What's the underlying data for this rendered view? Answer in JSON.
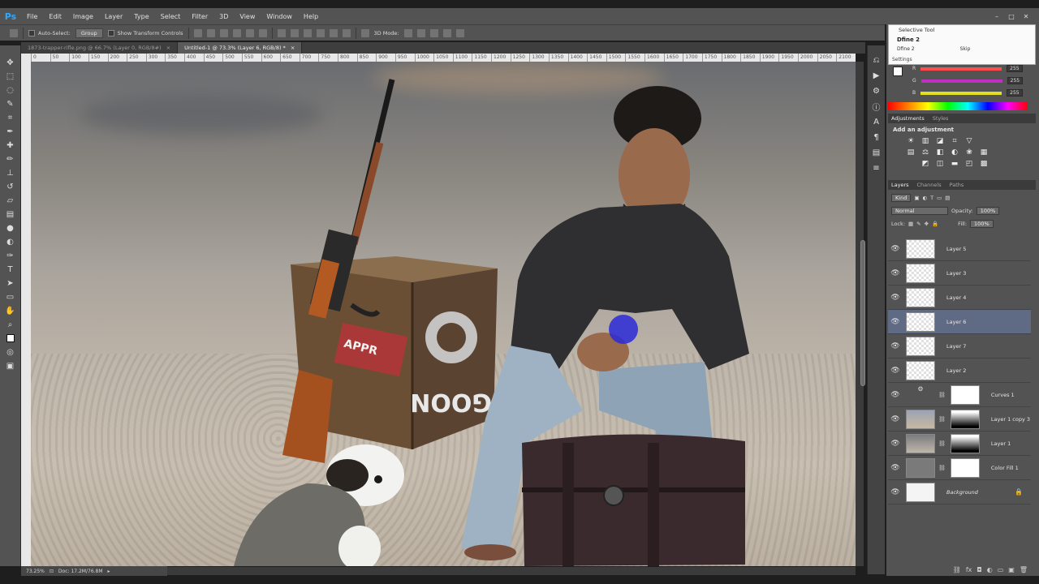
{
  "app": {
    "logo": "Ps"
  },
  "menu": [
    "File",
    "Edit",
    "Image",
    "Layer",
    "Type",
    "Select",
    "Filter",
    "3D",
    "View",
    "Window",
    "Help"
  ],
  "window_controls": [
    "–",
    "□",
    "✕"
  ],
  "options": {
    "auto_select_label": "Auto-Select:",
    "auto_select_value": "Group",
    "transform_label": "Show Transform Controls",
    "mode_label": "3D Mode:"
  },
  "tabs": [
    {
      "label": "1873-trapper-rifle.png @ 66.7% (Layer 0, RGB/8#)",
      "close": "×"
    },
    {
      "label": "Untitled-1 @ 73.3% (Layer 6, RGB/8) *",
      "close": "×"
    }
  ],
  "ruler": [
    "0",
    "50",
    "100",
    "150",
    "200",
    "250",
    "300",
    "350",
    "400",
    "450",
    "500",
    "550",
    "600",
    "650",
    "700",
    "750",
    "800",
    "850",
    "900",
    "950",
    "1000",
    "1050",
    "1100",
    "1150",
    "1200",
    "1250",
    "1300",
    "1350",
    "1400",
    "1450",
    "1500",
    "1550",
    "1600",
    "1650",
    "1700",
    "1750",
    "1800",
    "1850",
    "1900",
    "1950",
    "2000",
    "2050",
    "2100"
  ],
  "status": {
    "zoom": "73.25%",
    "doc": "Doc: 17.2M/76.8M"
  },
  "selective_tool": {
    "title": "Selective Tool",
    "name": "Dfine 2",
    "row_left": "Dfine 2",
    "row_right": "Skip",
    "settings": "Settings"
  },
  "color": {
    "labels": [
      "R",
      "G",
      "B"
    ],
    "values": [
      "255",
      "255",
      "255"
    ],
    "bar_colors": [
      "#ff4d4d",
      "#c030c0",
      "#e0e020"
    ]
  },
  "adjustments": {
    "tabs": [
      "Adjustments",
      "Styles"
    ],
    "label": "Add an adjustment",
    "icons": [
      "☀",
      "▥",
      "◪",
      "⌗",
      "▽",
      "",
      "▤",
      "⚖",
      "◧",
      "◐",
      "❀",
      "▦",
      "",
      "◩",
      "◫",
      "▬",
      "◰",
      "▩"
    ]
  },
  "layers_panel": {
    "tabs": [
      "Layers",
      "Channels",
      "Paths"
    ],
    "kind": "Kind",
    "blend": "Normal",
    "opacity_label": "Opacity:",
    "opacity_value": "100%",
    "lock_label": "Lock:",
    "fill_label": "Fill:",
    "fill_value": "100%",
    "layers": [
      {
        "name": "Layer 5",
        "selected": false
      },
      {
        "name": "Layer 3",
        "selected": false
      },
      {
        "name": "Layer 4",
        "selected": false
      },
      {
        "name": "Layer 6",
        "selected": true
      },
      {
        "name": "Layer 7",
        "selected": false
      },
      {
        "name": "Layer 2",
        "selected": false
      },
      {
        "name": "Curves 1",
        "selected": false
      },
      {
        "name": "Layer 1 copy 3",
        "selected": false
      },
      {
        "name": "Layer 1",
        "selected": false
      },
      {
        "name": "Color Fill 1",
        "selected": false
      },
      {
        "name": "Background",
        "selected": false
      }
    ]
  },
  "canvas": {
    "crate_text": "GOON",
    "sticker_text": "APPR"
  }
}
